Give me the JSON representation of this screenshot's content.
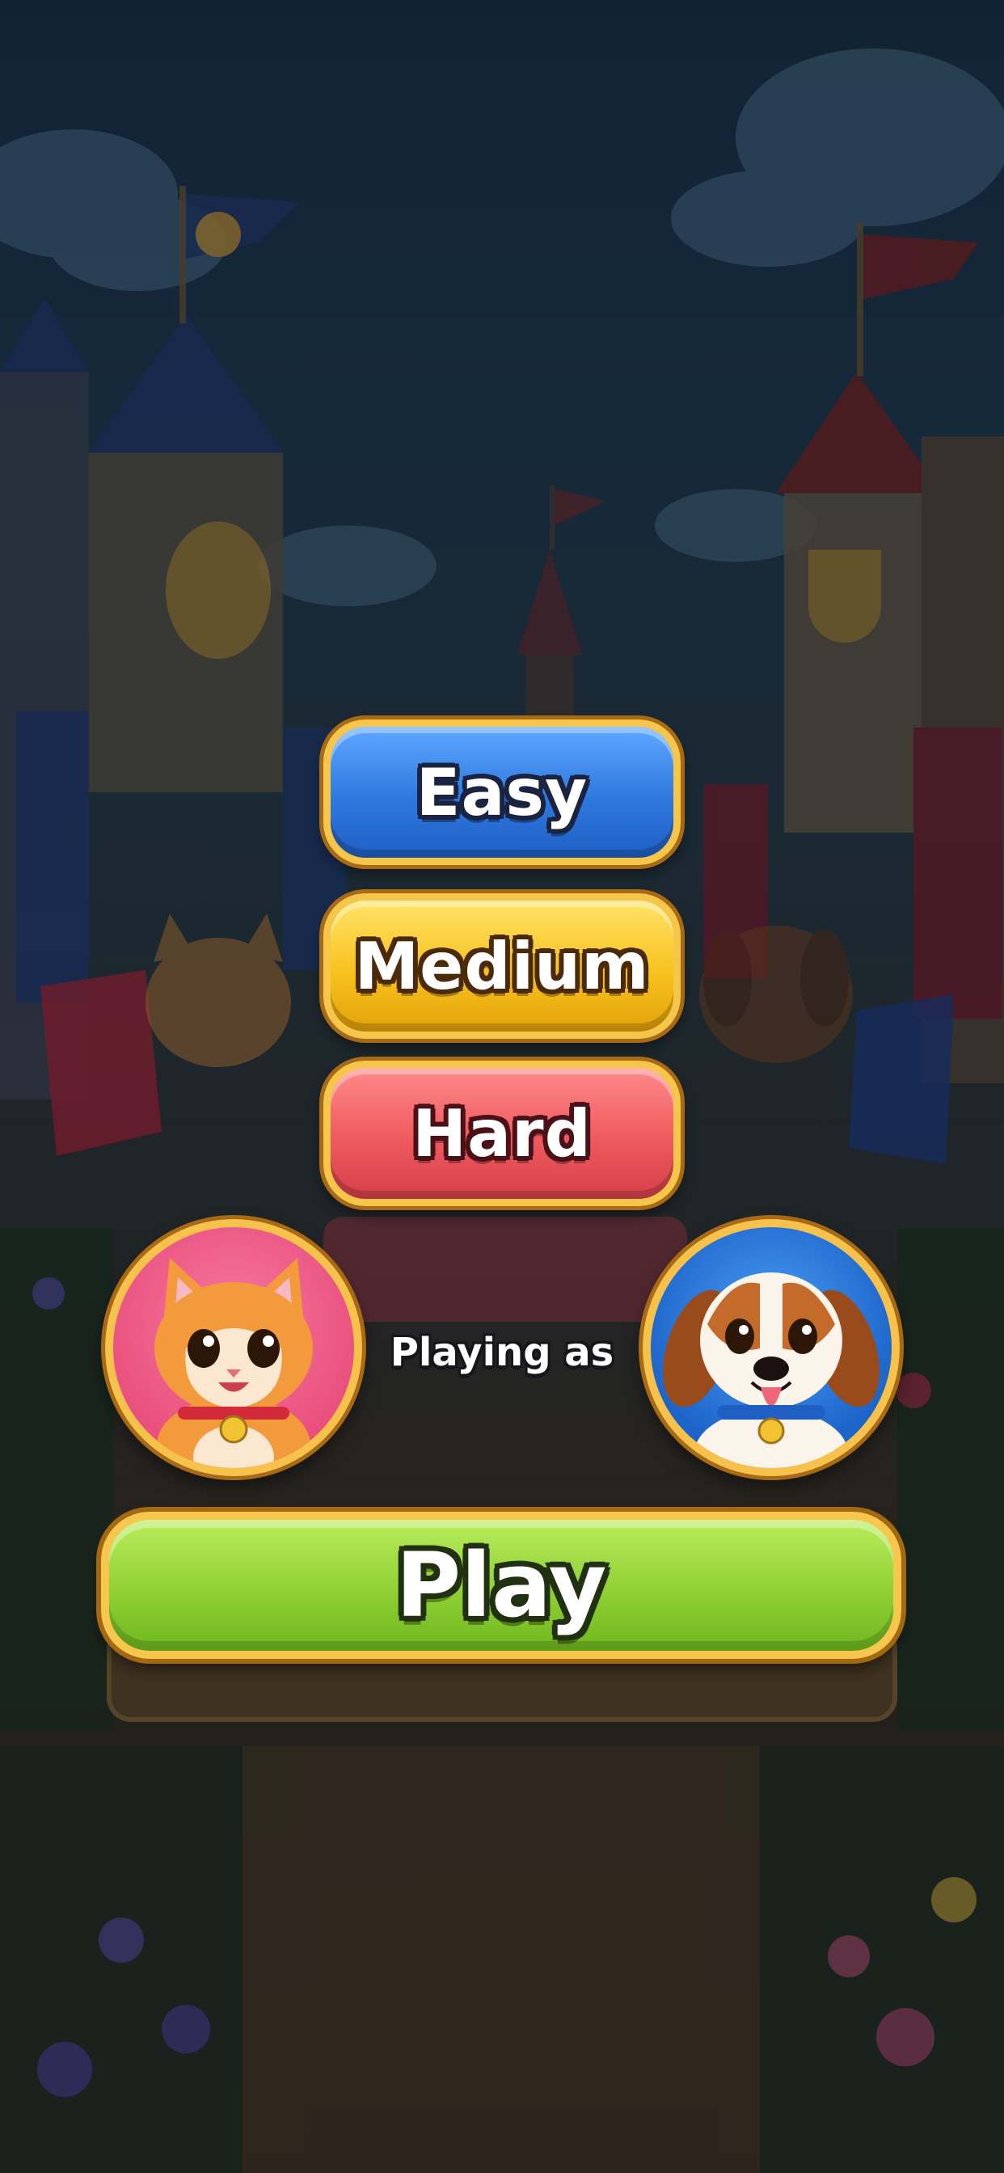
{
  "menu": {
    "difficulty": {
      "easy_label": "Easy",
      "medium_label": "Medium",
      "hard_label": "Hard"
    },
    "playing_as_label": "Playing as",
    "play_label": "Play"
  },
  "avatars": {
    "player": "cat-icon",
    "opponent": "dog-icon"
  },
  "colors": {
    "easy": "#2f78e0",
    "medium": "#f7c21d",
    "hard": "#ee5a5e",
    "play": "#8fd034",
    "gold_border": "#f5c64a"
  }
}
